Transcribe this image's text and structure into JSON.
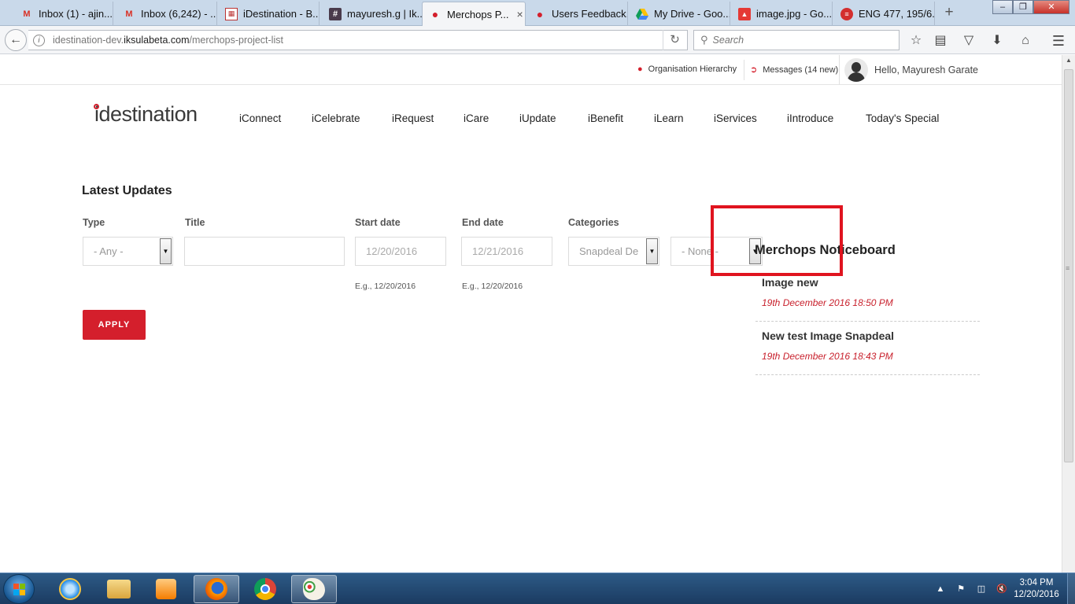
{
  "browser": {
    "tabs": [
      {
        "label": "Inbox (1) - ajin...",
        "icon": "gmail-icon",
        "active": false
      },
      {
        "label": "Inbox (6,242) - ...",
        "icon": "gmail-icon",
        "active": false
      },
      {
        "label": "iDestination - B...",
        "icon": "calendar-icon",
        "active": false
      },
      {
        "label": "mayuresh.g | Ik...",
        "icon": "slack-icon",
        "active": false
      },
      {
        "label": "Merchops P...",
        "icon": "pin-icon",
        "active": true
      },
      {
        "label": "Users Feedback...",
        "icon": "pin-icon",
        "active": false
      },
      {
        "label": "My Drive - Goo...",
        "icon": "drive-icon",
        "active": false
      },
      {
        "label": "image.jpg - Go...",
        "icon": "image-icon",
        "active": false
      },
      {
        "label": "ENG 477, 195/6...",
        "icon": "sport-icon",
        "active": false
      }
    ],
    "new_tab": "+",
    "close_glyph": "×",
    "url_domain_prefix": "idestination-dev.",
    "url_domain": "iksulabeta.com",
    "url_path": "/merchops-project-list",
    "search_placeholder": "Search",
    "window_buttons": {
      "minimize": "–",
      "restore": "❐",
      "close": "✕"
    },
    "colors": {
      "tab_strip": "#c9d9ea",
      "close_button": "#c7312a"
    }
  },
  "utility_bar": {
    "org_hierarchy": "Organisation Hierarchy",
    "messages": "Messages (14 new)",
    "greeting": "Hello, Mayuresh Garate"
  },
  "header": {
    "logo": "idestination",
    "nav": [
      "iConnect",
      "iCelebrate",
      "iRequest",
      "iCare",
      "iUpdate",
      "iBenefit",
      "iLearn",
      "iServices",
      "iIntroduce",
      "Today's Special"
    ]
  },
  "filters": {
    "section_title": "Latest Updates",
    "type_label": "Type",
    "type_value": "- Any -",
    "title_label": "Title",
    "title_value": "",
    "start_label": "Start date",
    "start_placeholder": "12/20/2016",
    "start_hint": "E.g., 12/20/2016",
    "end_label": "End date",
    "end_placeholder": "12/21/2016",
    "end_hint": "E.g., 12/20/2016",
    "categories_label": "Categories",
    "categories_value": "Snapdeal De",
    "second_select_value": "- None -",
    "apply": "APPLY"
  },
  "noticeboard": {
    "title": "Merchops Noticeboard",
    "items": [
      {
        "title": "Image new",
        "date": "19th December 2016 18:50 PM"
      },
      {
        "title": "New test Image Snapdeal",
        "date": "19th December 2016 18:43 PM"
      }
    ]
  },
  "taskbar": {
    "time": "3:04 PM",
    "date": "12/20/2016",
    "apps": [
      "ie-icon",
      "explorer-icon",
      "media-player-icon",
      "firefox-icon",
      "chrome-icon",
      "paint-icon"
    ]
  },
  "colors": {
    "accent": "#d41f2c",
    "highlight_box": "#e0141f",
    "date_text": "#c8202c"
  }
}
